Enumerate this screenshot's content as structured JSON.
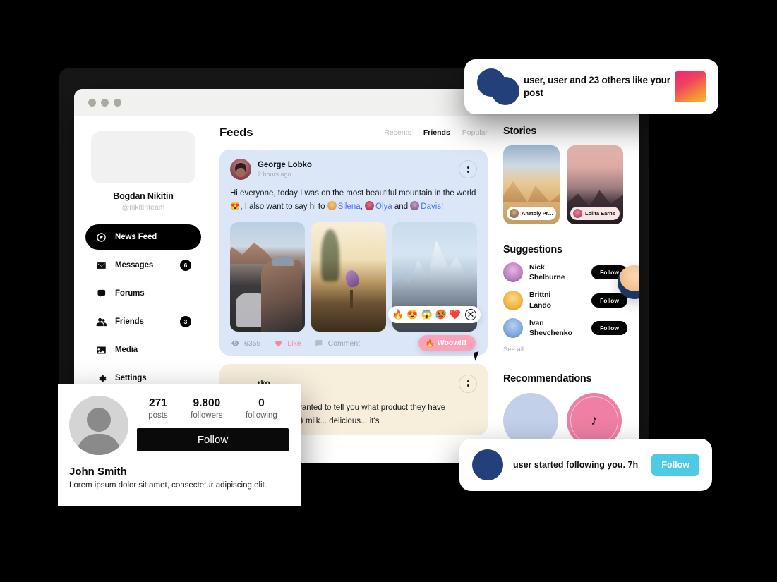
{
  "window": {
    "traffic_lights": [
      "close",
      "minimize",
      "maximize"
    ]
  },
  "sidebar": {
    "profile_name": "Bogdan Nikitin",
    "profile_handle": "@nikitinteam",
    "items": [
      {
        "label": "News Feed",
        "icon": "compass-icon",
        "badge": "",
        "active": true
      },
      {
        "label": "Messages",
        "icon": "envelope-icon",
        "badge": "6",
        "active": false
      },
      {
        "label": "Forums",
        "icon": "chat-icon",
        "badge": "",
        "active": false
      },
      {
        "label": "Friends",
        "icon": "people-icon",
        "badge": "3",
        "active": false
      },
      {
        "label": "Media",
        "icon": "image-icon",
        "badge": "",
        "active": false
      },
      {
        "label": "Settings",
        "icon": "gear-icon",
        "badge": "",
        "active": false
      }
    ]
  },
  "feed": {
    "title": "Feeds",
    "tabs": [
      {
        "label": "Recents",
        "active": false
      },
      {
        "label": "Friends",
        "active": true
      },
      {
        "label": "Popular",
        "active": false
      }
    ],
    "posts": [
      {
        "author": "George Lobko",
        "time": "2 hours ago",
        "text_part1": "Hi everyone, today I was on the most beautiful mountain in the world 😍, I also want to say hi to ",
        "mention1": "Silena",
        "sep1": ", ",
        "mention2": "Olya",
        "sep2": " and ",
        "mention3": "Davis",
        "text_end": "!",
        "views": "6355",
        "like_label": "Like",
        "comment_label": "Comment",
        "reactions": [
          "🔥",
          "😍",
          "😱",
          "🥵",
          "❤️"
        ],
        "reaction_close": "✕",
        "woow_label": "Woow!!!",
        "woow_emoji": "🔥"
      },
      {
        "author": "rko",
        "text_line1": "rful coffee today, I wanted to tell you what product they have",
        "text_line2": "atte with coconut 🥥 milk... delicious... it's"
      }
    ]
  },
  "stories": {
    "title": "Stories",
    "items": [
      {
        "name": "Anatoly Pr…"
      },
      {
        "name": "Lolita Earns"
      }
    ]
  },
  "suggestions": {
    "title": "Suggestions",
    "items": [
      {
        "name_line1": "Nick",
        "name_line2": "Shelburne",
        "button": "Follow"
      },
      {
        "name_line1": "Brittni",
        "name_line2": "Lando",
        "button": "Follow"
      },
      {
        "name_line1": "Ivan",
        "name_line2": "Shevchenko",
        "button": "Follow"
      }
    ],
    "see_all": "See all"
  },
  "recommendations": {
    "title": "Recommendations",
    "items": [
      {
        "icon": ""
      },
      {
        "icon": "♪"
      }
    ]
  },
  "notification_likes": {
    "text": "user, user and 23 others like your post"
  },
  "notification_follow": {
    "text": "user started following you. 7h",
    "button": "Follow"
  },
  "profile_card": {
    "posts_count": "271",
    "posts_label": "posts",
    "followers_count": "9.800",
    "followers_label": "followers",
    "following_count": "0",
    "following_label": "following",
    "follow_button": "Follow",
    "name": "John Smith",
    "bio": " Lorem ipsum dolor sit amet, consectetur adipiscing elit."
  },
  "colors": {
    "background": "#000000",
    "accent_dark": "#0a0a0a",
    "post_blue": "#dbe7f8",
    "post_cream": "#f7efdc",
    "like_pink": "#f4899e",
    "woow_pink": "#f9a3b9",
    "follow_cyan": "#4ecbe4",
    "avatar_navy": "#23407a",
    "link_blue": "#4b6ef5"
  }
}
